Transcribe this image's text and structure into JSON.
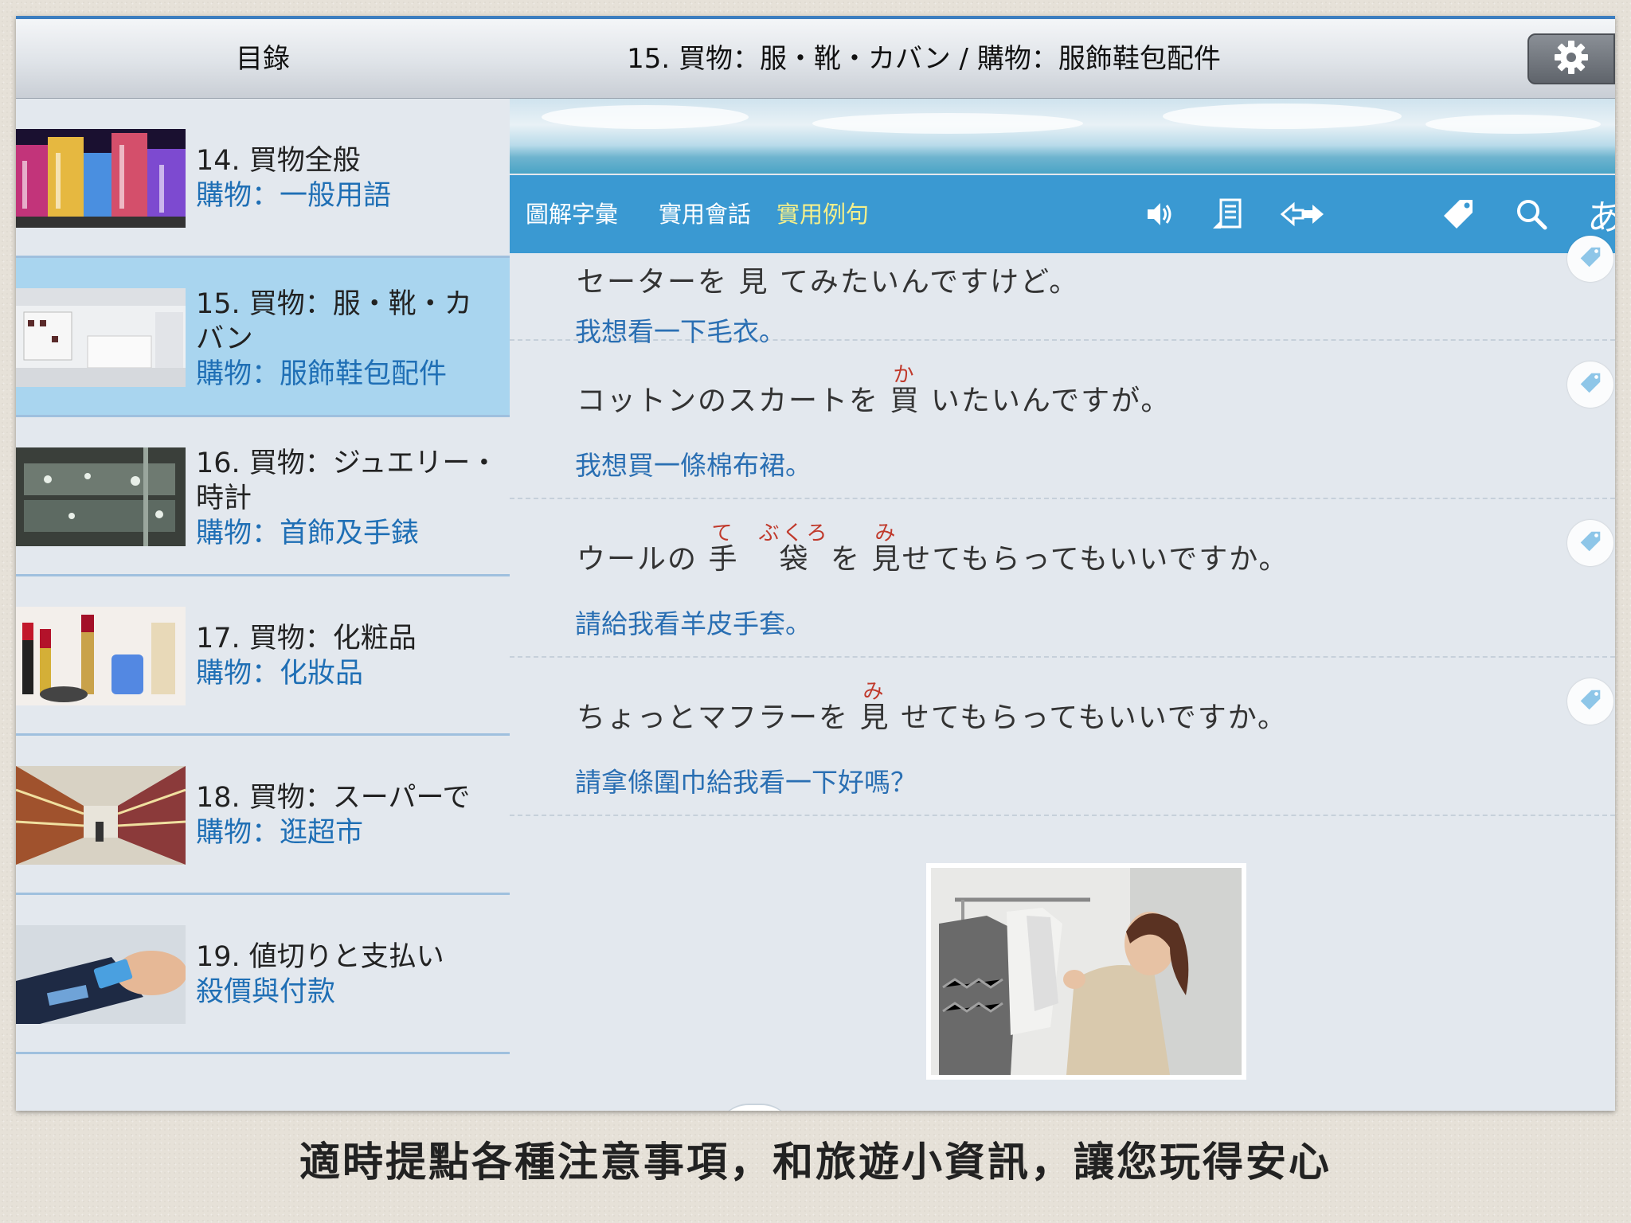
{
  "header": {
    "toc_title": "目錄",
    "lesson_title": "15. 買物：服・靴・カバン / 購物：服飾鞋包配件",
    "settings_icon": "gear-icon"
  },
  "sidebar": {
    "items": [
      {
        "jp": "14. 買物全般",
        "zh": "購物：一般用語",
        "active": false,
        "thumb": "shopping-street-thumbnail"
      },
      {
        "jp": "15. 買物：服・靴・カバン",
        "zh": "購物：服飾鞋包配件",
        "active": true,
        "thumb": "clothing-store-thumbnail"
      },
      {
        "jp": "16. 買物：ジュエリー・時計",
        "zh": "購物：首飾及手錶",
        "active": false,
        "thumb": "jewelry-case-thumbnail"
      },
      {
        "jp": "17. 買物：化粧品",
        "zh": "購物：化妝品",
        "active": false,
        "thumb": "cosmetics-thumbnail"
      },
      {
        "jp": "18. 買物：スーパーで",
        "zh": "購物：逛超市",
        "active": false,
        "thumb": "supermarket-thumbnail"
      },
      {
        "jp": "19. 値切りと支払い",
        "zh": "殺價與付款",
        "active": false,
        "thumb": "card-payment-thumbnail"
      }
    ]
  },
  "toolbar": {
    "tabs": [
      {
        "label": "圖解字彙",
        "active": false
      },
      {
        "label": "實用會話",
        "active": false
      },
      {
        "label": "實用例句",
        "active": true
      }
    ],
    "icons": [
      "speaker-icon",
      "notes-icon",
      "swap-arrows-icon",
      "tag-icon",
      "search-icon",
      "hiragana-toggle-icon"
    ],
    "hiragana_label": "あ"
  },
  "sentences": [
    {
      "jp": "セーターを 見 てみたいんですけど。",
      "zh": "我想看一下毛衣。"
    },
    {
      "jp_before": "コットンのスカートを ",
      "ruby1_base": "買",
      "ruby1_rt": "か",
      "jp_after": " いたいんですが。",
      "zh": "我想買一條棉布裙。"
    },
    {
      "jp_before": "ウールの ",
      "ruby1_base": "手",
      "ruby1_rt": "て",
      "ruby2_base": "袋",
      "ruby2_rt": "ぶくろ",
      "jp_mid": " を ",
      "ruby3_base": "見",
      "ruby3_rt": "み",
      "jp_after": "せてもらってもいいですか。",
      "zh": "請給我看羊皮手套。"
    },
    {
      "jp_before": "ちょっとマフラーを ",
      "ruby1_base": "見",
      "ruby1_rt": "み",
      "jp_after": " せてもらってもいいですか。",
      "zh": "請拿條圍巾給我看一下好嗎？"
    }
  ],
  "photo": "woman-browsing-clothes-rack",
  "caption": "適時提點各種注意事項，和旅遊小資訊，讓您玩得安心",
  "colors": {
    "toolbar_bg": "#3a99d2",
    "active_tab": "#f6f08a",
    "active_sidebar": "#a9d5ef",
    "chinese_text": "#1f6fb5",
    "furigana": "#c0392b"
  }
}
